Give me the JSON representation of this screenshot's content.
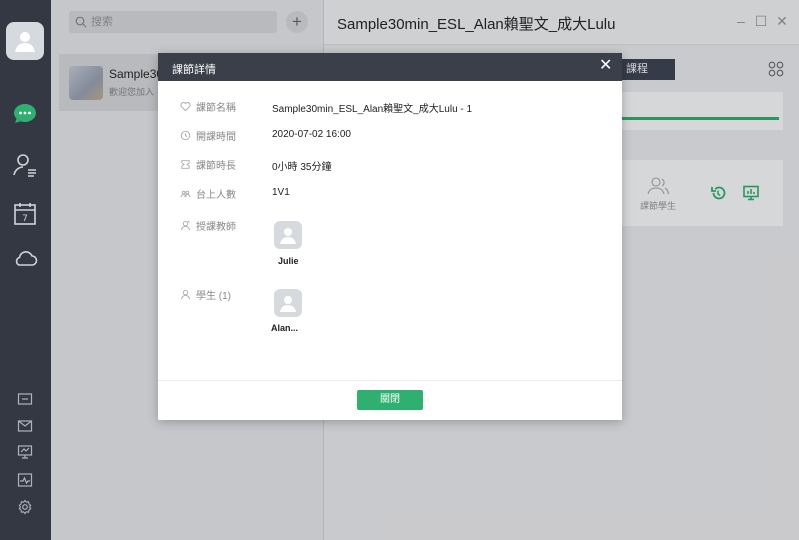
{
  "search": {
    "placeholder": "搜索"
  },
  "chat": {
    "title": "Sample30",
    "subtitle": "歡迎您加入"
  },
  "header": {
    "title": "Sample30min_ESL_Alan賴聖文_成大Lulu"
  },
  "tabs": {
    "course": "課程"
  },
  "student_card": {
    "label": "課節學生"
  },
  "progress": {
    "fraction": 1.0
  },
  "modal": {
    "title": "課節詳情",
    "fields": [
      {
        "label": "課節名稱",
        "value": "Sample30min_ESL_Alan賴聖文_成大Lulu - 1"
      },
      {
        "label": "開課時間",
        "value": "2020-07-02 16:00"
      },
      {
        "label": "課節時長",
        "value": "0小時 35分鐘"
      },
      {
        "label": "台上人數",
        "value": "1V1"
      },
      {
        "label": "授課教師",
        "value": ""
      },
      {
        "label": "學生 (1)",
        "value": ""
      }
    ],
    "teacher": "Julie",
    "student": "Alan...",
    "close_label": "關閉"
  },
  "colors": {
    "accent": "#2fb070",
    "rail": "#333842",
    "modal_header": "#3b3f4a"
  }
}
